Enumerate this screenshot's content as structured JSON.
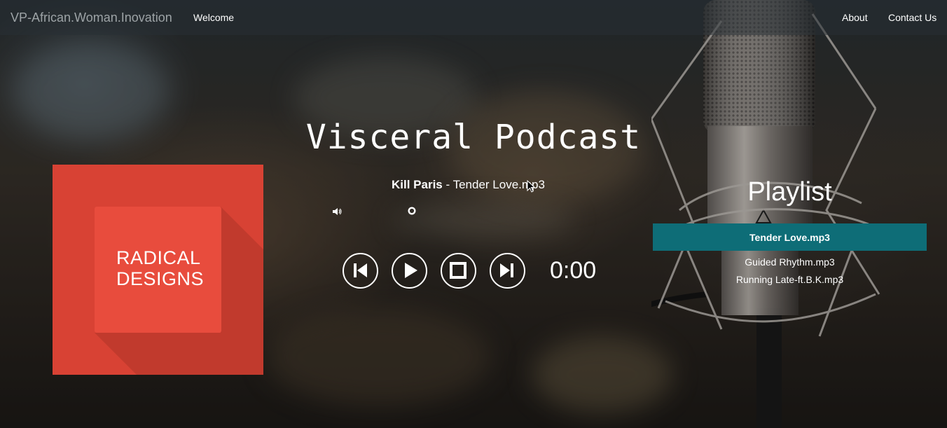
{
  "navbar": {
    "brand": "VP-African.Woman.Inovation",
    "welcome": "Welcome",
    "about": "About",
    "contact": "Contact Us"
  },
  "hero": {
    "title": "Visceral Podcast"
  },
  "album": {
    "line1": "RADICAL",
    "line2": "DESIGNS",
    "colors": {
      "background": "#d84234",
      "card": "#e84c3d"
    }
  },
  "player": {
    "artist": "Kill Paris",
    "separator": " - ",
    "track": "Tender Love.mp3",
    "time": "0:00",
    "icons": [
      "volume-icon",
      "volume-slider-knob",
      "previous-icon",
      "play-icon",
      "stop-icon",
      "next-icon"
    ]
  },
  "playlist": {
    "title": "Playlist",
    "active_item": "Tender Love.mp3",
    "items": [
      "Guided Rhythm.mp3",
      "Running Late-ft.B.K.mp3"
    ],
    "accent": "#0e6d77"
  }
}
